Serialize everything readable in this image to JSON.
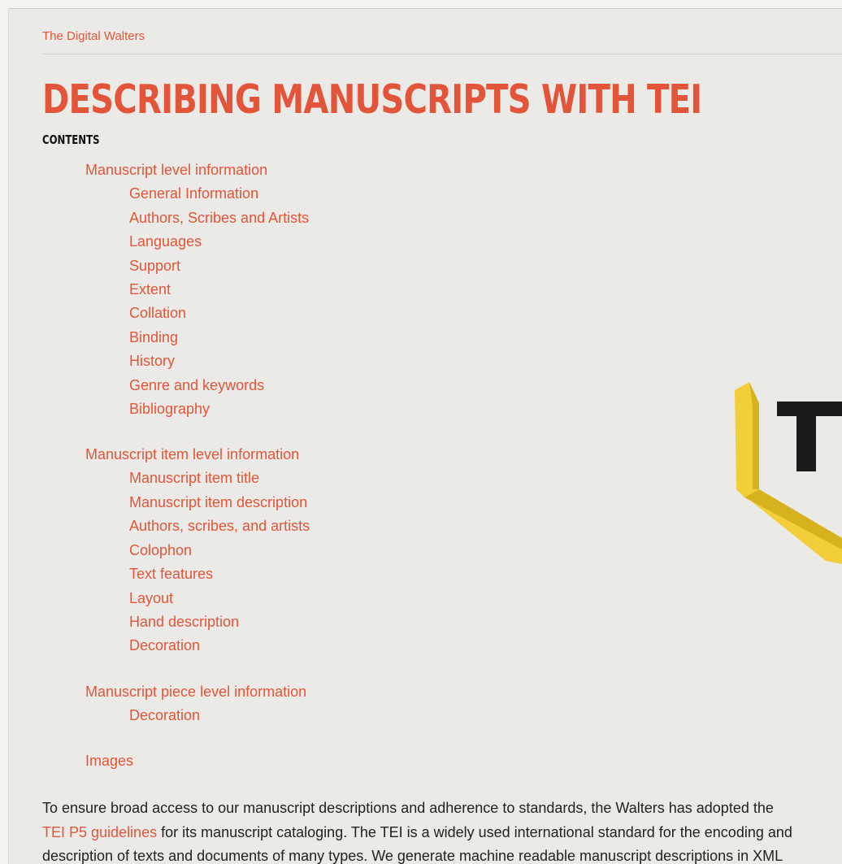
{
  "site": {
    "name": "The Digital Walters"
  },
  "page": {
    "title": "DESCRIBING MANUSCRIPTS WITH TEI",
    "contents_label": "CONTENTS"
  },
  "toc": {
    "manuscript_level": {
      "label": "Manuscript level information",
      "items": [
        "General Information",
        "Authors, Scribes and Artists",
        "Languages",
        "Support",
        "Extent",
        "Collation",
        "Binding",
        "History",
        "Genre and keywords",
        "Bibliography"
      ]
    },
    "item_level": {
      "label": "Manuscript item level information",
      "items": [
        "Manuscript item title",
        "Manuscript item description",
        "Authors, scribes, and artists",
        "Colophon",
        "Text features",
        "Layout",
        "Hand description",
        "Decoration"
      ]
    },
    "piece_level": {
      "label": "Manuscript piece level information",
      "items": [
        "Decoration"
      ]
    },
    "images": {
      "label": "Images"
    }
  },
  "intro": {
    "line1": "To ensure broad access to our manuscript descriptions and adherence to standards, the Walters has adopted the",
    "link": "TEI P5 guidelines",
    "line2_rest": " for its manuscript cataloging. The TEI is a widely used international standard for the encoding and",
    "line3": "description of texts and documents of many types. We generate machine readable manuscript descriptions in XML"
  },
  "logo": {
    "letter": "T",
    "colors": {
      "bracket": "#f2cf3a",
      "bracket_shade": "#d7b21f",
      "letter": "#1a1a1a"
    }
  },
  "colors": {
    "accent": "#e2553a",
    "background": "#eceae6",
    "text": "#222222"
  }
}
